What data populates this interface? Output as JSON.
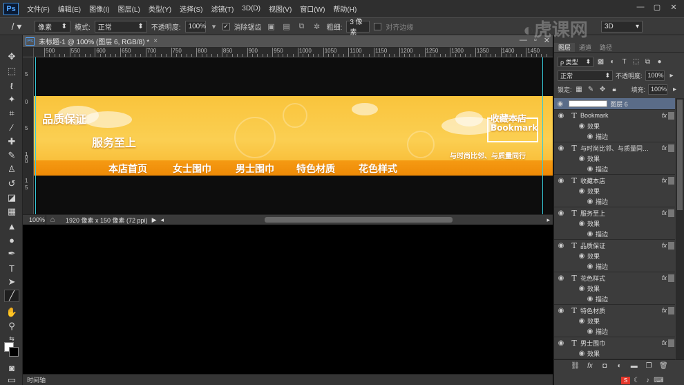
{
  "app": {
    "logo": "Ps",
    "menu": [
      "文件(F)",
      "编辑(E)",
      "图像(I)",
      "图层(L)",
      "类型(Y)",
      "选择(S)",
      "滤镜(T)",
      "3D(D)",
      "视图(V)",
      "窗口(W)",
      "帮助(H)"
    ],
    "window_controls": [
      "—",
      "▢",
      "✕"
    ]
  },
  "options": {
    "tool_preset": "/",
    "mode_dropdown": "像素",
    "mode_label": "模式:",
    "mode_value": "正常",
    "opacity_label": "不透明度:",
    "opacity_value": "100%",
    "antialias_label": "消除锯齿",
    "antialias_checked": "✓",
    "weight_label": "粗细:",
    "weight_value": "3 像素",
    "align_edges_label": "对齐边缘",
    "workspace_value": "3D"
  },
  "document": {
    "tab_title": "未标题-1 @ 100% (图层 6, RGB/8) *",
    "tab_close": "×",
    "ruler_h_labels": [
      "500",
      "550",
      "600",
      "650",
      "700",
      "750",
      "800",
      "850",
      "900",
      "950",
      "1000",
      "1050",
      "1100",
      "1150",
      "1200",
      "1250",
      "1300",
      "1350",
      "1400",
      "1450"
    ],
    "ruler_v_labels": [
      "5",
      "0",
      "5",
      "0",
      "1",
      "0",
      "1",
      "5"
    ],
    "zoom": "100%",
    "status_info": "1920 像素 x 150 像素 (72 ppi)",
    "status_arrow": "▶",
    "timeline_label": "时间轴"
  },
  "banner": {
    "text_quality": "品质保证",
    "text_service": "服务至上",
    "text_bookmark_cn": "收藏本店",
    "text_bookmark_en": "Bookmark",
    "text_slogan": "与时尚比邻、与质量同行",
    "nav": [
      "本店首页",
      "女士围巾",
      "男士围巾",
      "特色材质",
      "花色样式"
    ],
    "colors": {
      "background": "#fbc94a",
      "nav_strip": "#f3930d",
      "text": "#ffffff"
    }
  },
  "panel": {
    "tabs": [
      "图层",
      "通道",
      "路径"
    ],
    "filter_label": "ρ 类型",
    "blend_mode": "正常",
    "opacity_label": "不透明度:",
    "opacity_value": "100%",
    "lock_label": "锁定:",
    "fill_label": "填充:",
    "fill_value": "100%",
    "layers": [
      {
        "name": "图层 6",
        "type": "image",
        "selected": true
      },
      {
        "name": "Bookmark",
        "type": "T",
        "fx": "fx",
        "effects": "效果",
        "stroke": "描边"
      },
      {
        "name": "与时尚比邻、与质量同…",
        "type": "T",
        "fx": "fx",
        "effects": "效果",
        "stroke": "描边"
      },
      {
        "name": "收藏本店",
        "type": "T",
        "fx": "fx",
        "effects": "效果",
        "stroke": "描边"
      },
      {
        "name": "服务至上",
        "type": "T",
        "fx": "fx",
        "effects": "效果",
        "stroke": "描边"
      },
      {
        "name": "品质保证",
        "type": "T",
        "fx": "fx",
        "effects": "效果",
        "stroke": "描边"
      },
      {
        "name": "花色样式",
        "type": "T",
        "fx": "fx",
        "effects": "效果",
        "stroke": "描边"
      },
      {
        "name": "特色材质",
        "type": "T",
        "fx": "fx",
        "effects": "效果",
        "stroke": "描边"
      },
      {
        "name": "男士围巾",
        "type": "T",
        "fx": "fx",
        "effects": "效果"
      }
    ]
  },
  "watermark": {
    "text": "虎课网"
  }
}
